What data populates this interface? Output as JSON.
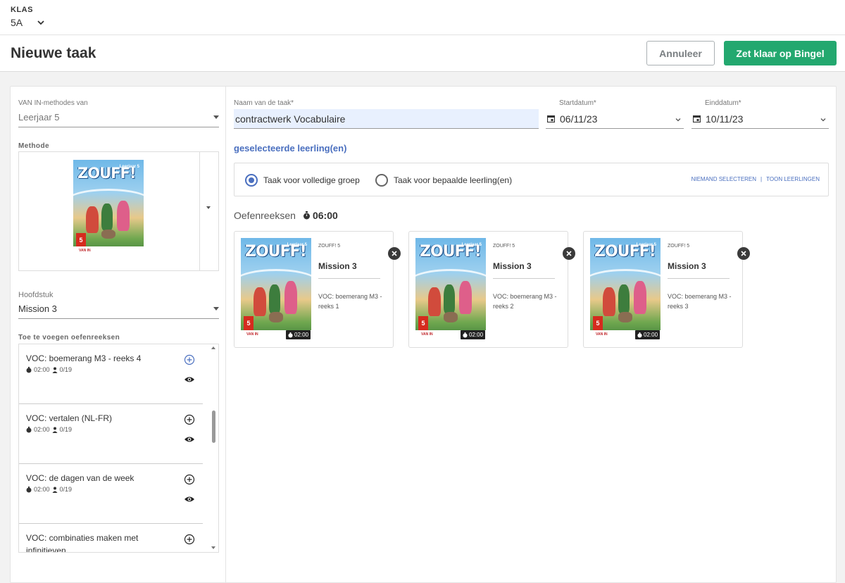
{
  "topbar": {
    "klas_label": "KLAS",
    "klas_value": "5A"
  },
  "header": {
    "title": "Nieuwe taak",
    "cancel_label": "Annuleer",
    "submit_label": "Zet klaar op Bingel"
  },
  "left": {
    "methods_label": "VAN IN-methodes van",
    "methods_value": "Leerjaar 5",
    "method_label": "Methode",
    "book": {
      "logo": "ZOUFF!",
      "sub": "Leerjaar 5",
      "number": "5",
      "publisher": "VAN IN"
    },
    "chapter_label": "Hoofdstuk",
    "chapter_value": "Mission 3",
    "add_label": "Toe te voegen oefenreeksen",
    "exercises": [
      {
        "title": "VOC: boemerang M3 - reeks 4",
        "time": "02:00",
        "students": "0/19"
      },
      {
        "title": "VOC: vertalen (NL-FR)",
        "time": "02:00",
        "students": "0/19"
      },
      {
        "title": "VOC: de dagen van de week",
        "time": "02:00",
        "students": "0/19"
      },
      {
        "title": "VOC: combinaties maken met infinitieven",
        "time": "",
        "students": ""
      }
    ]
  },
  "form": {
    "name_label": "Naam van de taak*",
    "name_value": "contractwerk Vocabulaire",
    "start_label": "Startdatum*",
    "start_value": "06/11/23",
    "end_label": "Einddatum*",
    "end_value": "10/11/23",
    "selected_link": "geselecteerde leerling(en)",
    "radio_full": "Taak voor volledige groep",
    "radio_some": "Taak voor bepaalde leerling(en)",
    "link_none": "NIEMAND SELECTEREN",
    "link_sep": "|",
    "link_show": "TOON LEERLINGEN",
    "series_title": "Oefenreeksen",
    "series_total": "06:00"
  },
  "tasks": [
    {
      "series": "ZOUFF! 5",
      "mission": "Mission 3",
      "desc": "VOC: boemerang M3 - reeks 1",
      "time": "02:00"
    },
    {
      "series": "ZOUFF! 5",
      "mission": "Mission 3",
      "desc": "VOC: boemerang M3 - reeks 2",
      "time": "02:00"
    },
    {
      "series": "ZOUFF! 5",
      "mission": "Mission 3",
      "desc": "VOC: boemerang M3 - reeks 3",
      "time": "02:00"
    }
  ],
  "colors": {
    "accent": "#4a6fbf",
    "primary_button": "#23a86f",
    "remove_button": "#3a3a3a"
  }
}
